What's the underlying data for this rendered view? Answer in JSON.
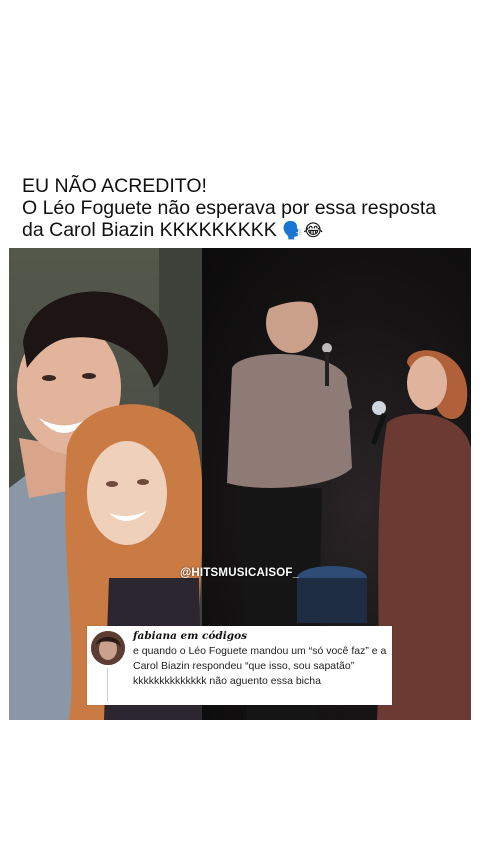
{
  "post": {
    "headline_line1": "EU NÃO ACREDITO!",
    "headline_line2": "O Léo Foguete não esperava por essa resposta",
    "headline_line3": "da Carol Biazin KKKKKKKKK",
    "headline_emojis": "🗣️😂"
  },
  "image": {
    "watermark": "@HITSMUSICAISOF_"
  },
  "tweet": {
    "author": "fabiana em códigos",
    "text": "e quando o Léo Foguete mandou um “só você faz” e a Carol Biazin respondeu “que isso, sou sapatão” kkkkkkkkkkkkkk não aguento essa bicha"
  }
}
